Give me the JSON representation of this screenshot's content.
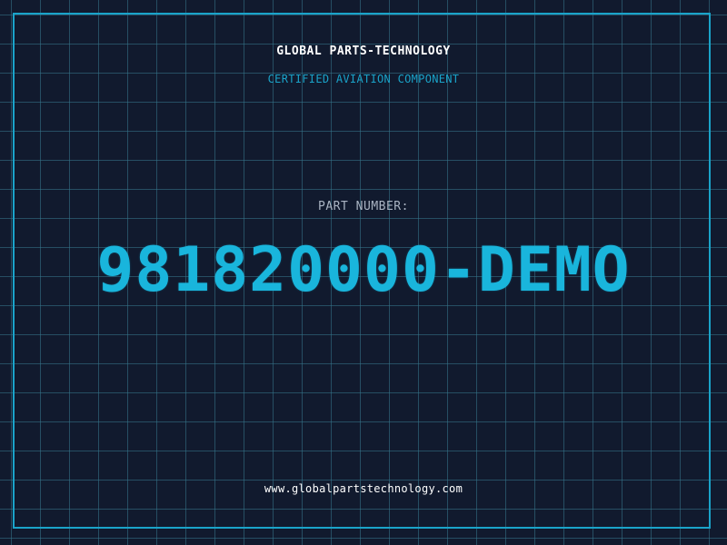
{
  "header": {
    "company_name": "GLOBAL PARTS-TECHNOLOGY",
    "tagline": "CERTIFIED AVIATION COMPONENT"
  },
  "part": {
    "label": "PART NUMBER:",
    "number": "981820000-DEMO"
  },
  "footer": {
    "website": "www.globalpartstechnology.com"
  },
  "colors": {
    "background": "#111a2e",
    "grid": "#36788e",
    "accent": "#1aa3c9",
    "part_number": "#19b5dc",
    "text_primary": "#ffffff",
    "text_muted": "#aab4c3"
  }
}
